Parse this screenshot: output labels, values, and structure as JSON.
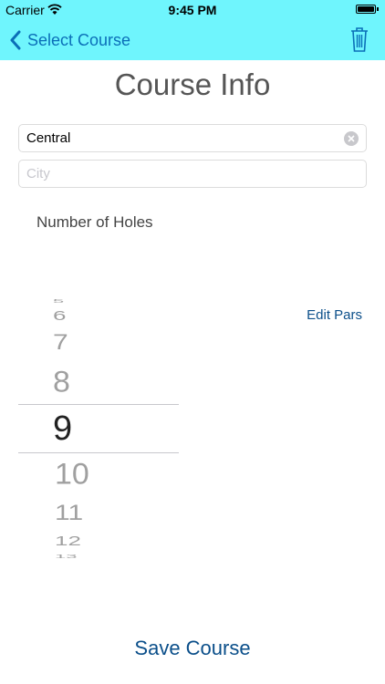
{
  "status_bar": {
    "carrier": "Carrier",
    "time": "9:45 PM"
  },
  "nav": {
    "back_label": "Select Course"
  },
  "title": "Course Info",
  "form": {
    "course_name_value": "Central",
    "city_placeholder": "City"
  },
  "holes_label": "Number of Holes",
  "edit_pars_label": "Edit Pars",
  "picker": {
    "options": [
      "5",
      "6",
      "7",
      "8",
      "9",
      "10",
      "11",
      "12",
      "13"
    ],
    "selected": "9"
  },
  "save_label": "Save Course",
  "colors": {
    "nav_bg": "#6ff5fd",
    "accent": "#0b6fb8",
    "link": "#0b4f8a"
  }
}
